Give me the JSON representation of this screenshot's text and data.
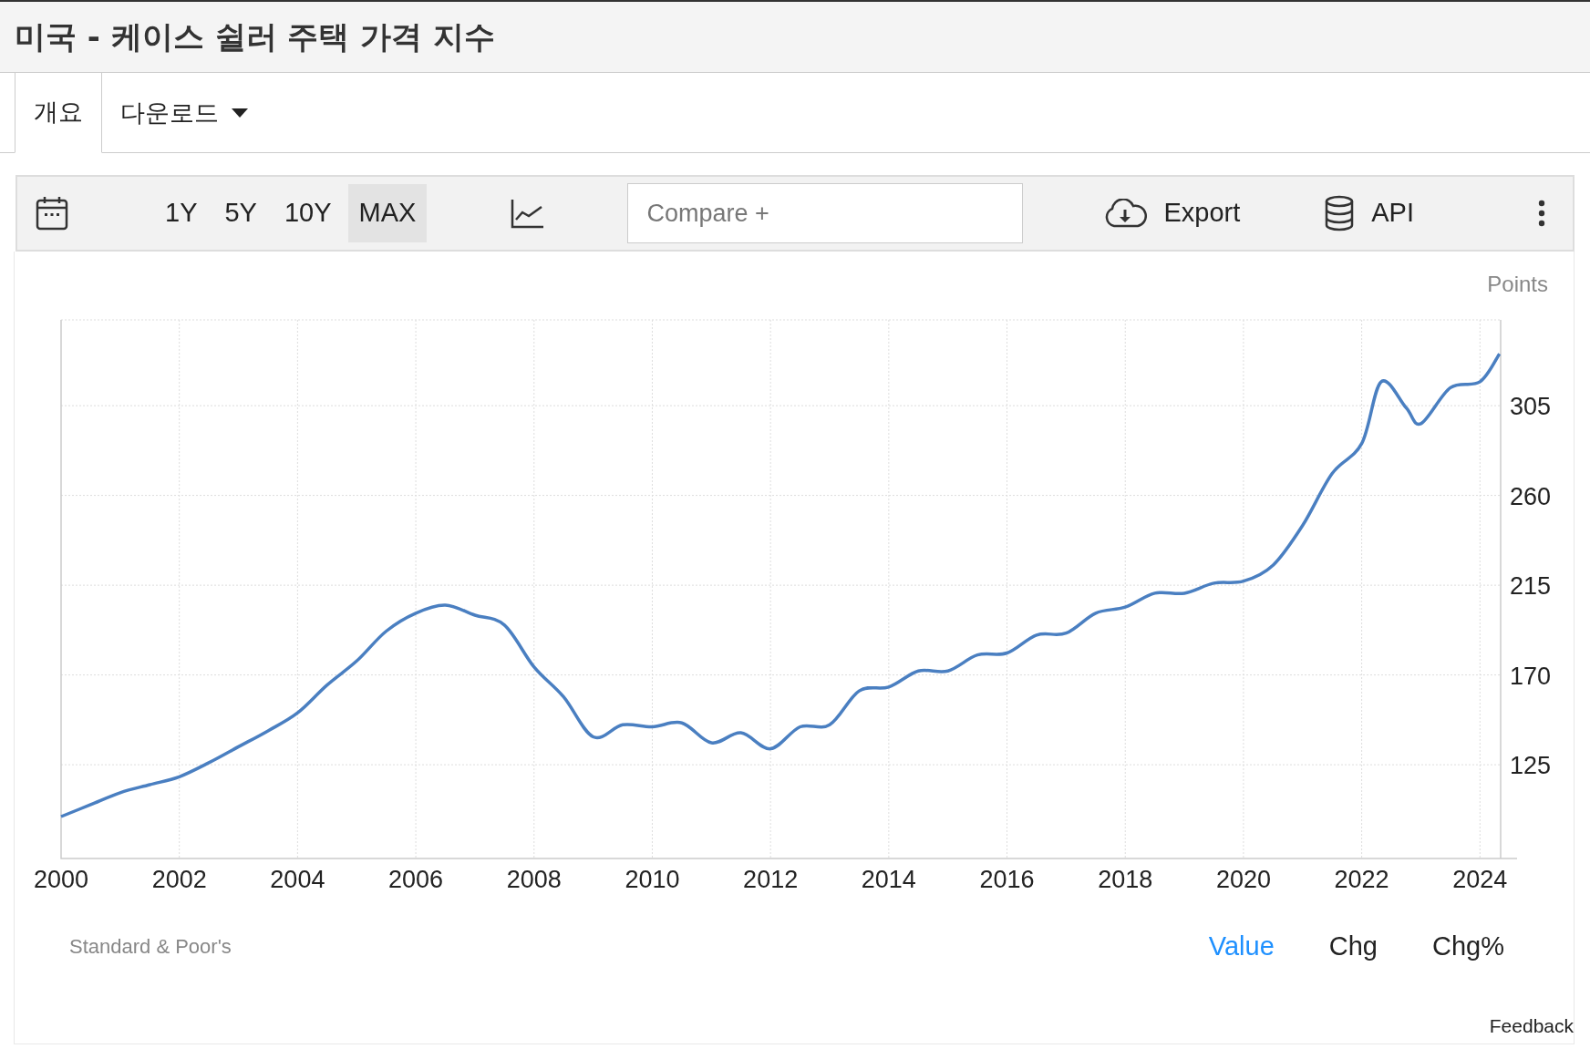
{
  "title": "미국 - 케이스 쉴러 주택 가격 지수",
  "tabs": [
    {
      "label": "개요",
      "selected": true,
      "kind": "tab"
    },
    {
      "label": "다운로드",
      "selected": false,
      "kind": "dropdown"
    }
  ],
  "toolbar": {
    "ranges": [
      {
        "label": "1Y",
        "selected": false
      },
      {
        "label": "5Y",
        "selected": false
      },
      {
        "label": "10Y",
        "selected": false
      },
      {
        "label": "MAX",
        "selected": true
      }
    ],
    "compare": {
      "placeholder": "Compare +"
    },
    "export": "Export",
    "api": "API"
  },
  "chart": {
    "source": "Standard & Poor's",
    "modes": [
      {
        "label": "Value",
        "selected": true
      },
      {
        "label": "Chg",
        "selected": false
      },
      {
        "label": "Chg%",
        "selected": false
      }
    ],
    "chart_data": {
      "type": "line",
      "ylabel": "Points",
      "grid": true,
      "x": [
        2000,
        2000.5,
        2001,
        2001.5,
        2002,
        2002.5,
        2003,
        2003.5,
        2004,
        2004.5,
        2005,
        2005.5,
        2006,
        2006.5,
        2007,
        2007.5,
        2008,
        2008.5,
        2009,
        2009.5,
        2010,
        2010.5,
        2011,
        2011.5,
        2012,
        2012.5,
        2013,
        2013.5,
        2014,
        2014.5,
        2015,
        2015.5,
        2016,
        2016.5,
        2017,
        2017.5,
        2018,
        2018.5,
        2019,
        2019.5,
        2020,
        2020.5,
        2021,
        2021.5,
        2022,
        2022.33,
        2022.75,
        2023,
        2023.5,
        2024,
        2024.33
      ],
      "series": [
        {
          "color": "#4a7fc1",
          "values": [
            99,
            105,
            111,
            115,
            119,
            126,
            134,
            142,
            151,
            165,
            177,
            192,
            201,
            205,
            200,
            195,
            174,
            159,
            139,
            145,
            144,
            146,
            136,
            141,
            133,
            144,
            145,
            162,
            164,
            172,
            172,
            180,
            181,
            190,
            191,
            201,
            204,
            211,
            211,
            216,
            217,
            225,
            245,
            271,
            286,
            317,
            304,
            296,
            314,
            317,
            331
          ]
        }
      ],
      "xlim": [
        2000,
        2024.35
      ],
      "ylim": [
        78,
        348
      ],
      "xticks": [
        2000,
        2002,
        2004,
        2006,
        2008,
        2010,
        2012,
        2014,
        2016,
        2018,
        2020,
        2022,
        2024
      ],
      "yticks": [
        125,
        170,
        215,
        260,
        305
      ]
    }
  },
  "feedback": "Feedback"
}
